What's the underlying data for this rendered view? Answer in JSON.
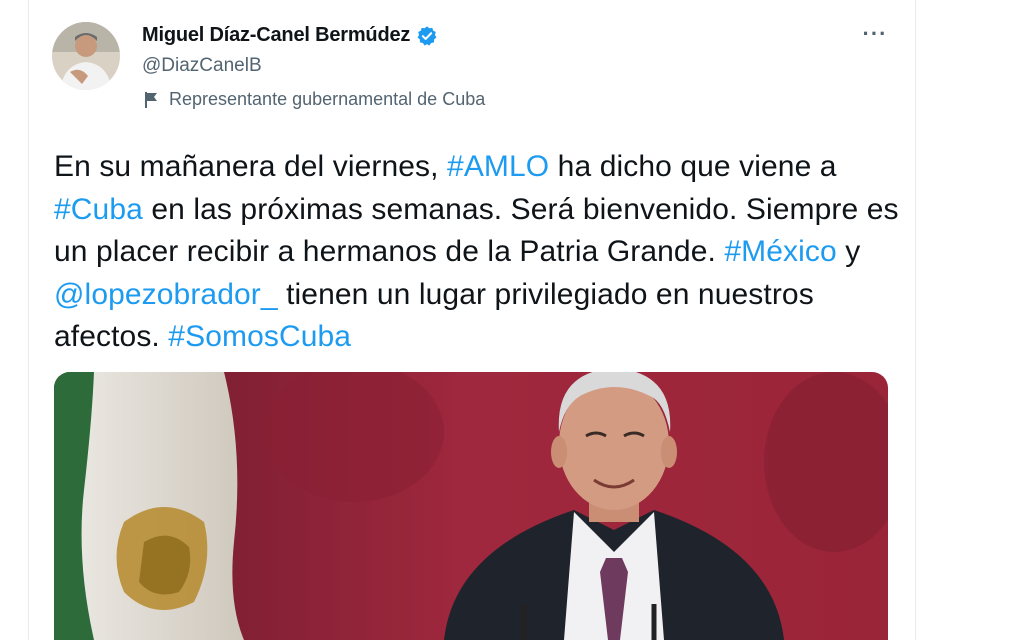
{
  "author": {
    "name": "Miguel Díaz-Canel Bermúdez",
    "handle": "@DiazCanelB",
    "label": "Representante gubernamental de Cuba",
    "verified": true
  },
  "tweet": {
    "segments": [
      {
        "t": "En su mañanera del viernes, ",
        "type": "text"
      },
      {
        "t": "#AMLO",
        "type": "link"
      },
      {
        "t": " ha dicho que viene a ",
        "type": "text"
      },
      {
        "t": "#Cuba",
        "type": "link"
      },
      {
        "t": " en las próximas semanas. Será bienvenido. Siempre es un placer recibir a hermanos de la Patria Grande. ",
        "type": "text"
      },
      {
        "t": "#México",
        "type": "link"
      },
      {
        "t": " y ",
        "type": "text"
      },
      {
        "t": "@lopezobrador_",
        "type": "link"
      },
      {
        "t": " tienen un lugar privilegiado en nuestros afectos. ",
        "type": "text"
      },
      {
        "t": "#SomosCuba",
        "type": "link"
      }
    ]
  },
  "colors": {
    "link": "#1d9bf0",
    "text": "#0f1419",
    "secondary": "#536471",
    "verified": "#1d9bf0"
  },
  "icons": {
    "more": "more-icon",
    "verified": "verified-badge-icon",
    "label": "flag-icon"
  }
}
